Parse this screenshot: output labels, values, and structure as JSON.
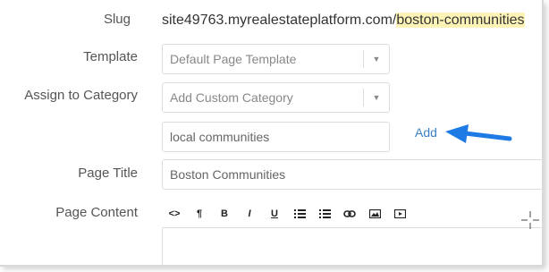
{
  "slug": {
    "label": "Slug",
    "prefix": "site49763.myrealestateplatform.com/",
    "value": "boston-communities"
  },
  "template": {
    "label": "Template",
    "selected": "Default Page Template"
  },
  "category": {
    "label": "Assign to Category",
    "selected": "Add Custom Category",
    "custom_input_value": "local communities",
    "add_label": "Add"
  },
  "page_title": {
    "label": "Page Title",
    "value": "Boston Communities"
  },
  "page_content": {
    "label": "Page Content",
    "toolbar": [
      {
        "name": "code-view-button",
        "icon": "code-icon",
        "glyph": "<>"
      },
      {
        "name": "paragraph-button",
        "icon": "pilcrow-icon",
        "glyph": "¶"
      },
      {
        "name": "bold-button",
        "icon": "bold-icon",
        "glyph": "B"
      },
      {
        "name": "italic-button",
        "icon": "italic-icon",
        "glyph": "I"
      },
      {
        "name": "underline-button",
        "icon": "underline-icon",
        "glyph": "U"
      },
      {
        "name": "bullet-list-button",
        "icon": "bullet-list-icon",
        "glyph": ""
      },
      {
        "name": "numbered-list-button",
        "icon": "numbered-list-icon",
        "glyph": ""
      },
      {
        "name": "link-button",
        "icon": "link-icon",
        "glyph": ""
      },
      {
        "name": "image-button",
        "icon": "image-icon",
        "glyph": ""
      },
      {
        "name": "video-button",
        "icon": "video-icon",
        "glyph": ""
      }
    ]
  },
  "colors": {
    "slug_highlight": "#fdf3b7",
    "link": "#3b7fc4",
    "annotation_arrow": "#1e7be6"
  }
}
